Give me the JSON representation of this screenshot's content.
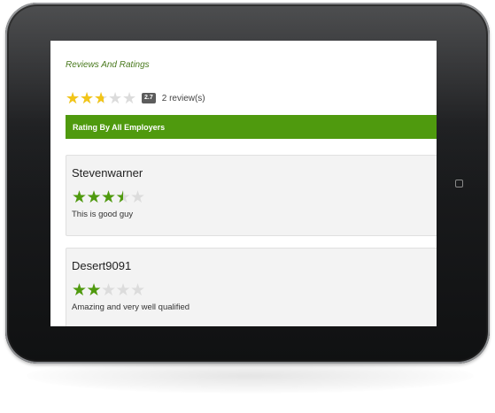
{
  "section_title": "Reviews And Ratings",
  "summary": {
    "rating": 2.7,
    "max_rating": 5,
    "score_badge": "2.7",
    "review_count_text": "2 review(s)"
  },
  "filter_bar": {
    "label": "Rating By All Employers"
  },
  "reviews": [
    {
      "name": "Stevenwarner",
      "rating": 3.5,
      "comment": "This is good guy"
    },
    {
      "name": "Desert9091",
      "rating": 2,
      "comment": "Amazing and very well qualified"
    }
  ],
  "colors": {
    "accent_green": "#4f9a0e",
    "summary_star": "#f2c518",
    "empty_star": "#dcdcdc",
    "title_green": "#4a7a1e"
  },
  "icons": {
    "star": "star-icon",
    "home_button": "home-button-icon"
  }
}
